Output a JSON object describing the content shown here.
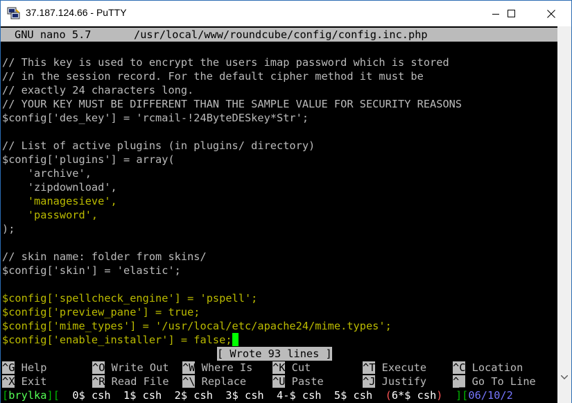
{
  "window": {
    "title": "37.187.124.66 - PuTTY"
  },
  "icons": {
    "app": "putty-icon",
    "minimize": "minimize-icon",
    "maximize": "maximize-icon",
    "close": "close-icon",
    "scroll_down": "scroll-arrow-icon"
  },
  "nano_header": {
    "version": "GNU nano 5.7",
    "path": "/usr/local/www/roundcube/config/config.inc.php"
  },
  "content": [
    "// This key is used to encrypt the users imap password which is stored",
    "// in the session record. For the default cipher method it must be",
    "// exactly 24 characters long.",
    "// YOUR KEY MUST BE DIFFERENT THAN THE SAMPLE VALUE FOR SECURITY REASONS",
    "$config['des_key'] = 'rcmail-!24ByteDESkey*Str';",
    "",
    "// List of active plugins (in plugins/ directory)",
    "$config['plugins'] = array(",
    "    'archive',",
    "    'zipdownload',",
    "    'managesieve',",
    "    'password',",
    ");",
    "",
    "// skin name: folder from skins/",
    "$config['skin'] = 'elastic';",
    "",
    "$config['spellcheck_engine'] = 'pspell';",
    "$config['preview_pane'] = true;",
    "$config['mime_types'] = '/usr/local/etc/apache24/mime.types';",
    "$config['enable_installer'] = false;"
  ],
  "status_message": "[ Wrote 93 lines ]",
  "shortcuts_row1": [
    {
      "key": "^G",
      "label": "Help"
    },
    {
      "key": "^O",
      "label": "Write Out"
    },
    {
      "key": "^W",
      "label": "Where Is"
    },
    {
      "key": "^K",
      "label": "Cut"
    },
    {
      "key": "^T",
      "label": "Execute"
    },
    {
      "key": "^C",
      "label": "Location"
    }
  ],
  "shortcuts_row2": [
    {
      "key": "^X",
      "label": "Exit"
    },
    {
      "key": "^R",
      "label": "Read File"
    },
    {
      "key": "^\\",
      "label": "Replace"
    },
    {
      "key": "^U",
      "label": "Paste"
    },
    {
      "key": "^J",
      "label": "Justify"
    },
    {
      "key": "^_",
      "label": "Go To Line"
    }
  ],
  "screen_bar": {
    "session": "brylka",
    "windows_text": "  0$ csh  1$ csh  2$ csh  3$ csh  4-$ csh  5$ csh",
    "active_window": "6*$ csh",
    "date": "06/10/2"
  },
  "colors": {
    "terminal_bg": "#000000",
    "text": "#bbbbbb",
    "yellow": "#bbbb00",
    "cursor": "#00ff00",
    "screen_green": "#00bb00"
  }
}
